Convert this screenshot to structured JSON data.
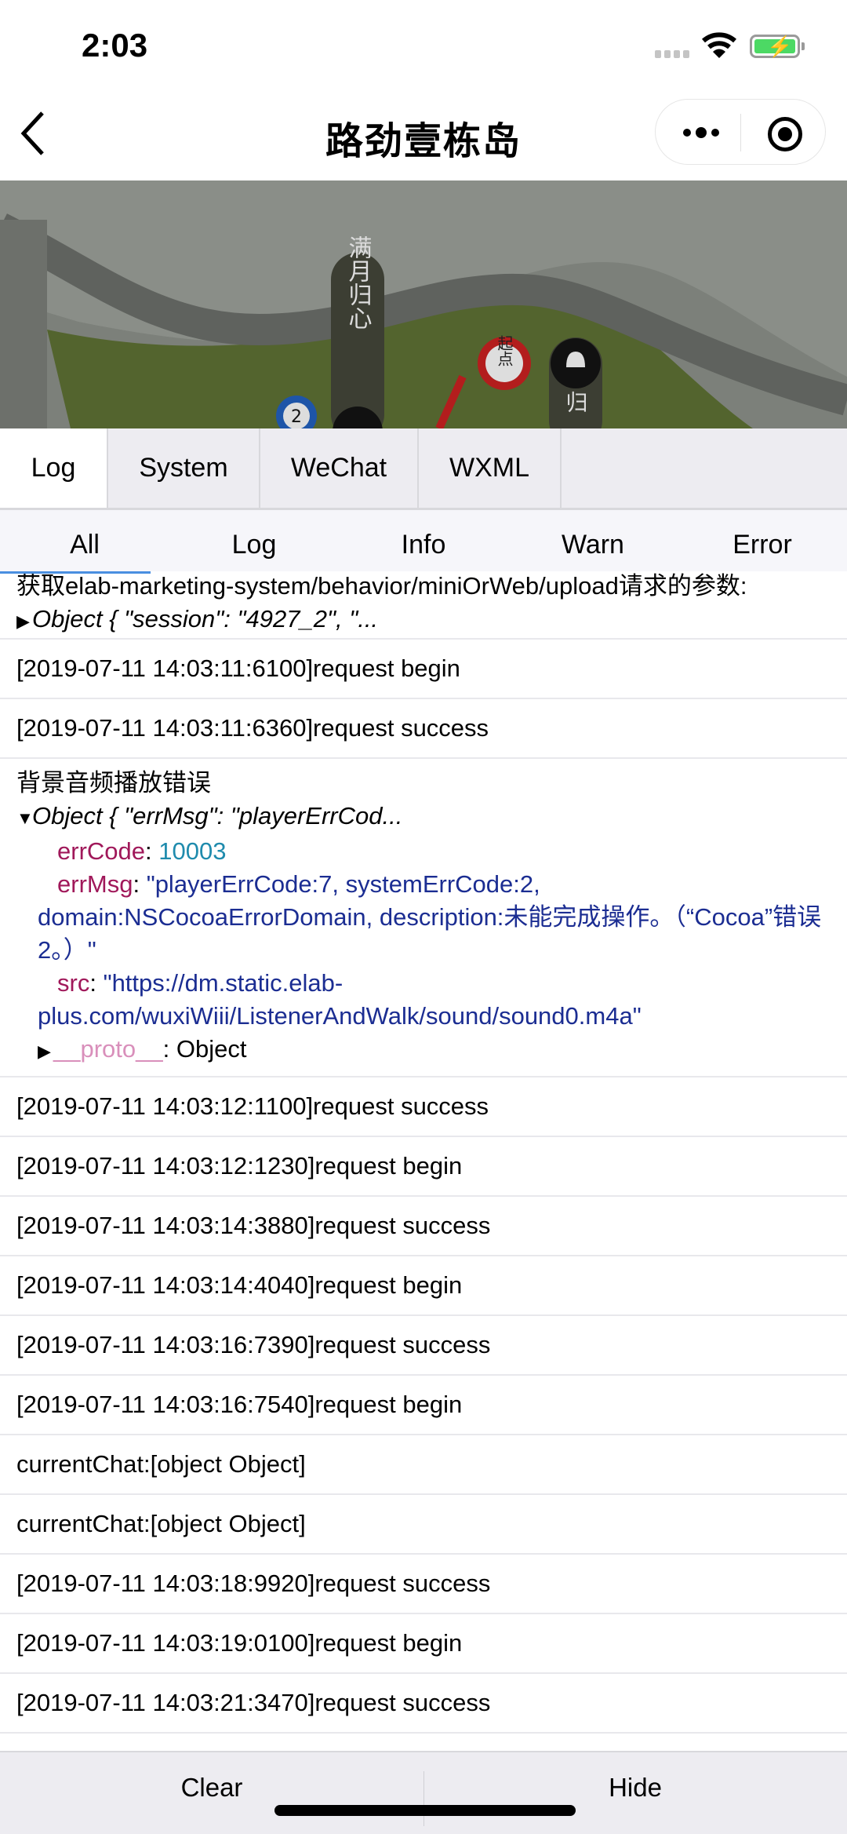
{
  "status_bar": {
    "time": "2:03"
  },
  "nav": {
    "title": "路劲壹栋岛"
  },
  "map": {
    "labels": [
      "满月归心",
      "起点",
      "2",
      "归"
    ]
  },
  "tabs": [
    "Log",
    "System",
    "WeChat",
    "WXML"
  ],
  "filters": [
    "All",
    "Log",
    "Info",
    "Warn",
    "Error"
  ],
  "logs": [
    {
      "type": "object",
      "label": "获取elab-marketing-system/behavior/miniOrWeb/upload请求的参数:",
      "summary": "Object { \"session\": \"4927_2\", \"...",
      "expanded": false
    },
    {
      "type": "text",
      "text": "[2019-07-11 14:03:11:6100]request begin"
    },
    {
      "type": "text",
      "text": "[2019-07-11 14:03:11:6360]request success"
    },
    {
      "type": "object",
      "label": "背景音频播放错误",
      "summary": "Object { \"errMsg\": \"playerErrCod...",
      "expanded": true,
      "props": [
        {
          "key": "errCode",
          "value": "10003",
          "kind": "number"
        },
        {
          "key": "errMsg",
          "value": "\"playerErrCode:7, systemErrCode:2, domain:NSCocoaErrorDomain, description:未能完成操作。（“Cocoa”错误 2。）\"",
          "kind": "string"
        },
        {
          "key": "src",
          "value": "\"https://dm.static.elab-plus.com/wuxiWiii/ListenerAndWalk/sound/sound0.m4a\"",
          "kind": "string"
        }
      ],
      "proto": {
        "key": "__proto__",
        "value": "Object"
      }
    },
    {
      "type": "text",
      "text": "[2019-07-11 14:03:12:1100]request success"
    },
    {
      "type": "text",
      "text": "[2019-07-11 14:03:12:1230]request begin"
    },
    {
      "type": "text",
      "text": "[2019-07-11 14:03:14:3880]request success"
    },
    {
      "type": "text",
      "text": "[2019-07-11 14:03:14:4040]request begin"
    },
    {
      "type": "text",
      "text": "[2019-07-11 14:03:16:7390]request success"
    },
    {
      "type": "text",
      "text": "[2019-07-11 14:03:16:7540]request begin"
    },
    {
      "type": "text",
      "text": "currentChat:[object Object]"
    },
    {
      "type": "text",
      "text": "currentChat:[object Object]"
    },
    {
      "type": "text",
      "text": "[2019-07-11 14:03:18:9920]request success"
    },
    {
      "type": "text",
      "text": "[2019-07-11 14:03:19:0100]request begin"
    },
    {
      "type": "text",
      "text": "[2019-07-11 14:03:21:3470]request success"
    }
  ],
  "bottom": {
    "clear_label": "Clear",
    "hide_label": "Hide"
  },
  "colors": {
    "key": "#a0185a",
    "number": "#1f8bad",
    "string": "#1b2d92",
    "active_indicator": "#4a8fe0",
    "battery": "#4cd964"
  }
}
